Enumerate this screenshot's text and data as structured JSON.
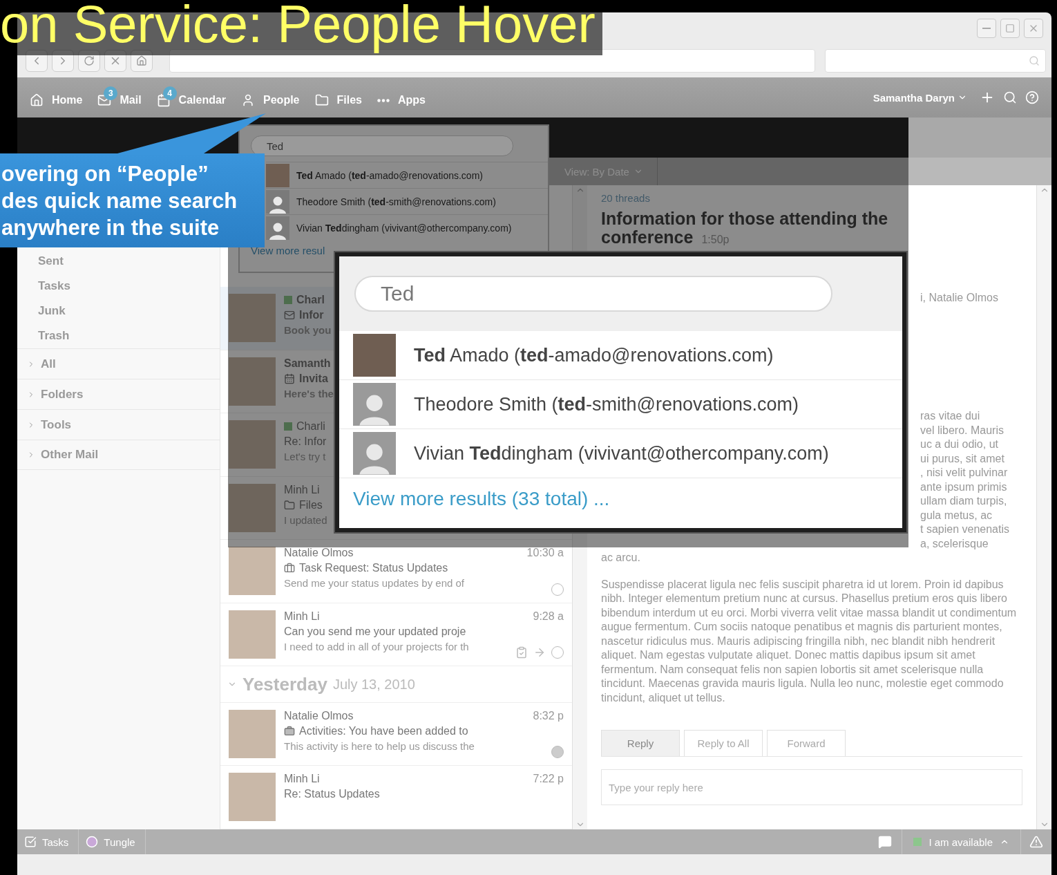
{
  "slide_title": "on Service: People Hover",
  "nav": [
    {
      "label": "Home",
      "kind": "home"
    },
    {
      "label": "Mail",
      "kind": "mail",
      "badge": "3"
    },
    {
      "label": "Calendar",
      "kind": "calendar",
      "badge": "4"
    },
    {
      "label": "People",
      "kind": "people"
    },
    {
      "label": "Files",
      "kind": "files"
    },
    {
      "label": "Apps",
      "kind": "apps"
    }
  ],
  "user": "Samantha Daryn",
  "view_menu": "View: By Date",
  "sidebar": [
    {
      "label": "Sent",
      "kind": "folder"
    },
    {
      "label": "Tasks",
      "kind": "folder"
    },
    {
      "label": "Junk",
      "kind": "folder"
    },
    {
      "label": "Trash",
      "kind": "folder"
    },
    {
      "label": "All",
      "kind": "section"
    },
    {
      "label": "Folders",
      "kind": "section"
    },
    {
      "label": "Tools",
      "kind": "section"
    },
    {
      "label": "Other Mail",
      "kind": "section"
    }
  ],
  "messages": [
    {
      "kind": "message",
      "sender": "Charl",
      "subject": {
        "kind": "mail",
        "text": "Infor"
      },
      "preview": "Book you",
      "online": true,
      "selected": true,
      "bold": true
    },
    {
      "kind": "message",
      "sender": "Samanth",
      "subject": {
        "kind": "calendar",
        "text": "Invita"
      },
      "preview": "Here's the",
      "online": false,
      "selected": false,
      "bold": true
    },
    {
      "kind": "message",
      "sender": "Charli",
      "subject": {
        "kind": "plain",
        "text": "Re: Infor"
      },
      "preview": "Let's try t",
      "online": true,
      "selected": false,
      "bold": false
    },
    {
      "kind": "message",
      "sender": "Minh Li",
      "subject": {
        "kind": "folder",
        "text": "Files"
      },
      "preview": "I updated",
      "online": false,
      "selected": false,
      "bold": false
    },
    {
      "kind": "message",
      "sender": "Natalie Olmos",
      "subject": {
        "kind": "task",
        "text": "Task Request: Status Updates"
      },
      "preview": "Send me your status updates by end of",
      "time": "10:30 a",
      "online": false,
      "selected": false,
      "bold": false,
      "filled": false
    },
    {
      "kind": "message",
      "sender": "Minh Li",
      "subject": {
        "kind": "plain",
        "text": "Can you send me your updated proje"
      },
      "preview": "I need to add in all of your projects for th",
      "time": "9:28 a",
      "online": false,
      "selected": false,
      "bold": false,
      "filled": false,
      "actions": true
    },
    {
      "kind": "group",
      "title": "Yesterday",
      "date": "July 13, 2010"
    },
    {
      "kind": "message",
      "sender": "Natalie Olmos",
      "subject": {
        "kind": "briefcase",
        "text": "Activities: You have been added to"
      },
      "preview": "This activity is here to help us discuss the",
      "time": "8:32 p",
      "online": false,
      "selected": false,
      "bold": false,
      "filled": true
    },
    {
      "kind": "message",
      "sender": "Minh Li",
      "subject": {
        "kind": "plain",
        "text": "Re: Status Updates"
      },
      "time": "7:22 p",
      "online": false,
      "selected": false,
      "bold": false
    }
  ],
  "thread": {
    "count": "20 threads",
    "title": "Information for those attending the conference",
    "time": "1:50p",
    "participants": "i, Natalie Olmos",
    "fragments": [
      "ras vitae dui",
      "vel libero. Mauris",
      "uc a dui odio, ut",
      "ui purus, sit amet",
      ", nisi velit pulvinar",
      "ante ipsum primis",
      "ullam diam turpis,",
      "gula metus, ac",
      "t sapien venenatis",
      "a, scelerisque"
    ],
    "closing": "ac arcu.",
    "paragraph": "Suspendisse placerat ligula nec felis suscipit pharetra id ut lorem. Proin id dapibus nibh. Integer elementum pretium nunc at cursus. Phasellus pretium eros quis libero bibendum interdum ut eu orci. Morbi viverra velit vitae massa blandit ut condimentum augue fermentum. Cum sociis natoque penatibus et magnis dis parturient montes, nascetur ridiculus mus. Mauris adipiscing fringilla nibh, nec blandit nibh hendrerit aliquet. Nam egestas vulputate aliquet. Donec mattis dapibus ipsum sit amet fermentum. Nam consequat felis non sapien lobortis sit amet scelerisque nulla tincidunt. Maecenas gravida mauris ligula. Nulla leo nunc, molestie eget commodo tincidunt, aliquet ut tellus."
  },
  "reply": {
    "tabs": [
      {
        "label": "Reply",
        "selected": true
      },
      {
        "label": "Reply to All",
        "selected": false
      },
      {
        "label": "Forward",
        "selected": false
      }
    ],
    "placeholder": "Type your reply here"
  },
  "status_bar": {
    "items": [
      {
        "label": "Tasks",
        "kind": "tasks"
      },
      {
        "label": "Tungle",
        "kind": "tungle"
      }
    ],
    "availability": "I am available"
  },
  "quick_search_small": {
    "query": "Ted",
    "results": [
      {
        "text": "**Ted** Amado (**ted**-amado@renovations.com)",
        "kind": "photo"
      },
      {
        "text": "Theodore Smith (**ted**-smith@renovations.com)",
        "kind": "silhouette"
      },
      {
        "text": "Vivian **Ted**dingham (vivivant@othercompany.com)",
        "kind": "silhouette"
      }
    ],
    "more": "View more resul"
  },
  "quick_search": {
    "query": "Ted",
    "results": [
      {
        "text": "**Ted** Amado (**ted**-amado@renovations.com)",
        "kind": "photo"
      },
      {
        "text": "Theodore Smith (**ted**-smith@renovations.com)",
        "kind": "silhouette"
      },
      {
        "text": "Vivian **Ted**dingham (vivivant@othercompany.com)",
        "kind": "silhouette"
      }
    ],
    "more": "View more results (33 total) ..."
  },
  "callout": {
    "lines": [
      "overing on “People”",
      "des quick name search",
      "anywhere in the suite"
    ]
  }
}
